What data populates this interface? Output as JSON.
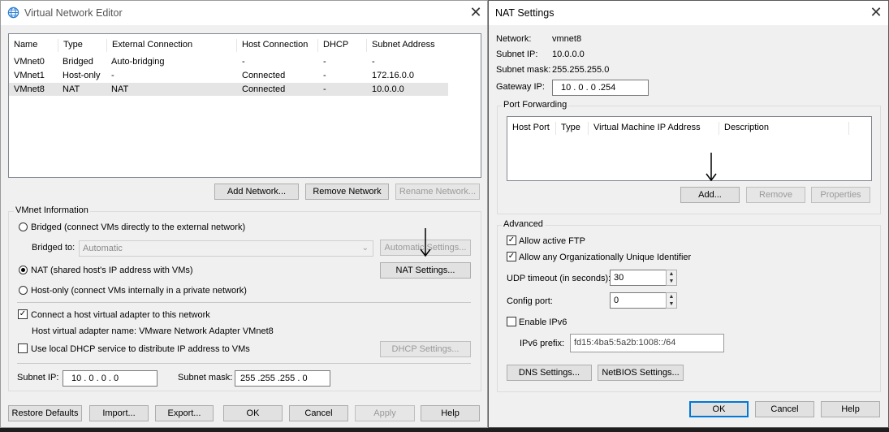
{
  "vne": {
    "title": "Virtual Network Editor",
    "columns": [
      "Name",
      "Type",
      "External Connection",
      "Host Connection",
      "DHCP",
      "Subnet Address"
    ],
    "rows": [
      [
        "VMnet0",
        "Bridged",
        "Auto-bridging",
        "-",
        "-",
        "-"
      ],
      [
        "VMnet1",
        "Host-only",
        "-",
        "Connected",
        "-",
        "172.16.0.0"
      ],
      [
        "VMnet8",
        "NAT",
        "NAT",
        "Connected",
        "-",
        "10.0.0.0"
      ]
    ],
    "selected_row": 2,
    "buttons": {
      "add_network": "Add Network...",
      "remove_network": "Remove Network",
      "rename_network": "Rename Network..."
    },
    "vmnet_info": {
      "label": "VMnet Information",
      "bridged_label": "Bridged (connect VMs directly to the external network)",
      "bridged_to_label": "Bridged to:",
      "bridged_to_value": "Automatic",
      "automatic_settings": "Automatic Settings...",
      "nat_label": "NAT (shared host's IP address with VMs)",
      "nat_settings": "NAT Settings...",
      "hostonly_label": "Host-only (connect VMs internally in a private network)",
      "selected_mode": "nat",
      "connect_adapter_label": "Connect a host virtual adapter to this network",
      "connect_adapter_checked": true,
      "adapter_name_label": "Host virtual adapter name: VMware Network Adapter VMnet8",
      "dhcp_label": "Use local DHCP service to distribute IP address to VMs",
      "dhcp_checked": false,
      "dhcp_settings": "DHCP Settings...",
      "subnet_ip_label": "Subnet IP:",
      "subnet_ip": "10 . 0 . 0 . 0",
      "subnet_mask_label": "Subnet mask:",
      "subnet_mask": "255 .255 .255 . 0"
    },
    "bottom": {
      "restore": "Restore Defaults",
      "import": "Import...",
      "export": "Export...",
      "ok": "OK",
      "cancel": "Cancel",
      "apply": "Apply",
      "help": "Help"
    }
  },
  "nat": {
    "title": "NAT Settings",
    "network_label": "Network:",
    "network_value": "vmnet8",
    "subnet_ip_label": "Subnet IP:",
    "subnet_ip_value": "10.0.0.0",
    "subnet_mask_label": "Subnet mask:",
    "subnet_mask_value": "255.255.255.0",
    "gateway_label": "Gateway IP:",
    "gateway_value": "10 . 0 . 0 .254",
    "port_forwarding": {
      "label": "Port Forwarding",
      "columns": [
        "Host Port",
        "Type",
        "Virtual Machine IP Address",
        "Description"
      ],
      "add": "Add...",
      "remove": "Remove",
      "properties": "Properties"
    },
    "advanced": {
      "label": "Advanced",
      "allow_ftp_label": "Allow active FTP",
      "allow_ftp_checked": true,
      "allow_oui_label": "Allow any Organizationally Unique Identifier",
      "allow_oui_checked": true,
      "udp_label": "UDP timeout (in seconds):",
      "udp_value": "30",
      "config_port_label": "Config port:",
      "config_port_value": "0",
      "ipv6_label": "Enable IPv6",
      "ipv6_checked": false,
      "ipv6_prefix_label": "IPv6 prefix:",
      "ipv6_prefix_value": "fd15:4ba5:5a2b:1008::/64",
      "dns_settings": "DNS Settings...",
      "netbios_settings": "NetBIOS Settings..."
    },
    "bottom": {
      "ok": "OK",
      "cancel": "Cancel",
      "help": "Help"
    }
  },
  "colors": {
    "dialog_bg": "#f0f0f0",
    "selection": "#e5e5e5",
    "accent": "#0078d7",
    "disabled_text": "#9a9a9a"
  },
  "icons": {
    "app_icon": "globe-icon",
    "close": "close-icon",
    "annotation": "down-arrow-icon"
  }
}
